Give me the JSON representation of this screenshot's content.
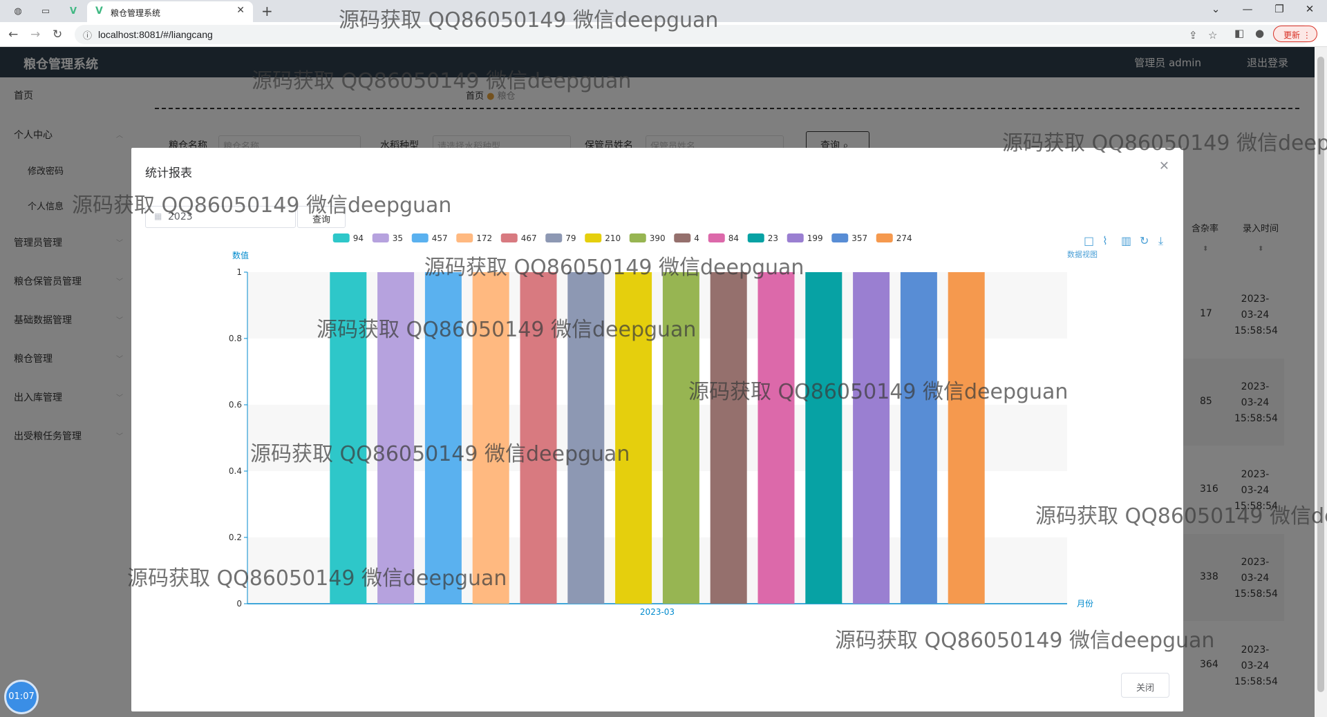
{
  "browser": {
    "tab_title": "粮仓管理系统",
    "url": "localhost:8081/#/liangcang",
    "update_label": "更新"
  },
  "header": {
    "app_title": "粮仓管理系统",
    "user_label": "管理员 admin",
    "logout_label": "退出登录"
  },
  "sidebar": {
    "items": [
      {
        "label": "首页"
      },
      {
        "label": "个人中心"
      },
      {
        "label": "修改密码"
      },
      {
        "label": "个人信息"
      },
      {
        "label": "管理员管理"
      },
      {
        "label": "粮仓保管员管理"
      },
      {
        "label": "基础数据管理"
      },
      {
        "label": "粮仓管理"
      },
      {
        "label": "出入库管理"
      },
      {
        "label": "出受粮任务管理"
      }
    ]
  },
  "breadcrumb": {
    "home": "首页",
    "current": "粮仓"
  },
  "filters": {
    "name_label": "粮仓名称",
    "name_placeholder": "粮仓名称",
    "type_label": "水稻种型",
    "type_placeholder": "请选择水稻种型",
    "keeper_label": "保管员姓名",
    "keeper_placeholder": "保管员姓名",
    "query_label": "查询"
  },
  "table": {
    "col_impurity": "含杂率",
    "col_time": "录入时间",
    "rows": [
      {
        "impurity": "17",
        "time": "2023-03-24 15:58:54"
      },
      {
        "impurity": "85",
        "time": "2023-03-24 15:58:54"
      },
      {
        "impurity": "316",
        "time": "2023-03-24 15:58:54"
      },
      {
        "impurity": "338",
        "time": "2023-03-24 15:58:54"
      },
      {
        "impurity": "364",
        "time": "2023-03-24 15:58:54"
      }
    ]
  },
  "modal": {
    "title": "统计报表",
    "year_value": "2023",
    "query_label": "查询",
    "close_label": "关闭"
  },
  "chart_data": {
    "type": "bar",
    "categories": [
      "2023-03"
    ],
    "xlabel": "月份",
    "ylabel": "数值",
    "ylim": [
      0,
      1
    ],
    "yticks": [
      "0",
      "0.2",
      "0.4",
      "0.6",
      "0.8",
      "1"
    ],
    "legend_position": "top",
    "toolbox_tooltip": "数据视图",
    "series": [
      {
        "name": "94",
        "values": [
          1
        ],
        "color": "#2ec7c9"
      },
      {
        "name": "35",
        "values": [
          1
        ],
        "color": "#b6a2de"
      },
      {
        "name": "457",
        "values": [
          1
        ],
        "color": "#5ab1ef"
      },
      {
        "name": "172",
        "values": [
          1
        ],
        "color": "#ffb980"
      },
      {
        "name": "467",
        "values": [
          1
        ],
        "color": "#d87a80"
      },
      {
        "name": "79",
        "values": [
          1
        ],
        "color": "#8d98b3"
      },
      {
        "name": "210",
        "values": [
          1
        ],
        "color": "#e5cf0d"
      },
      {
        "name": "390",
        "values": [
          1
        ],
        "color": "#97b552"
      },
      {
        "name": "4",
        "values": [
          1
        ],
        "color": "#95706d"
      },
      {
        "name": "84",
        "values": [
          1
        ],
        "color": "#dc69aa"
      },
      {
        "name": "23",
        "values": [
          1
        ],
        "color": "#07a2a4"
      },
      {
        "name": "199",
        "values": [
          1
        ],
        "color": "#9a7fd1"
      },
      {
        "name": "357",
        "values": [
          1
        ],
        "color": "#588dd5"
      },
      {
        "name": "274",
        "values": [
          1
        ],
        "color": "#f5994e"
      }
    ]
  },
  "timer": {
    "text": "01:07"
  },
  "watermark": "源码获取 QQ86050149 微信deepguan"
}
